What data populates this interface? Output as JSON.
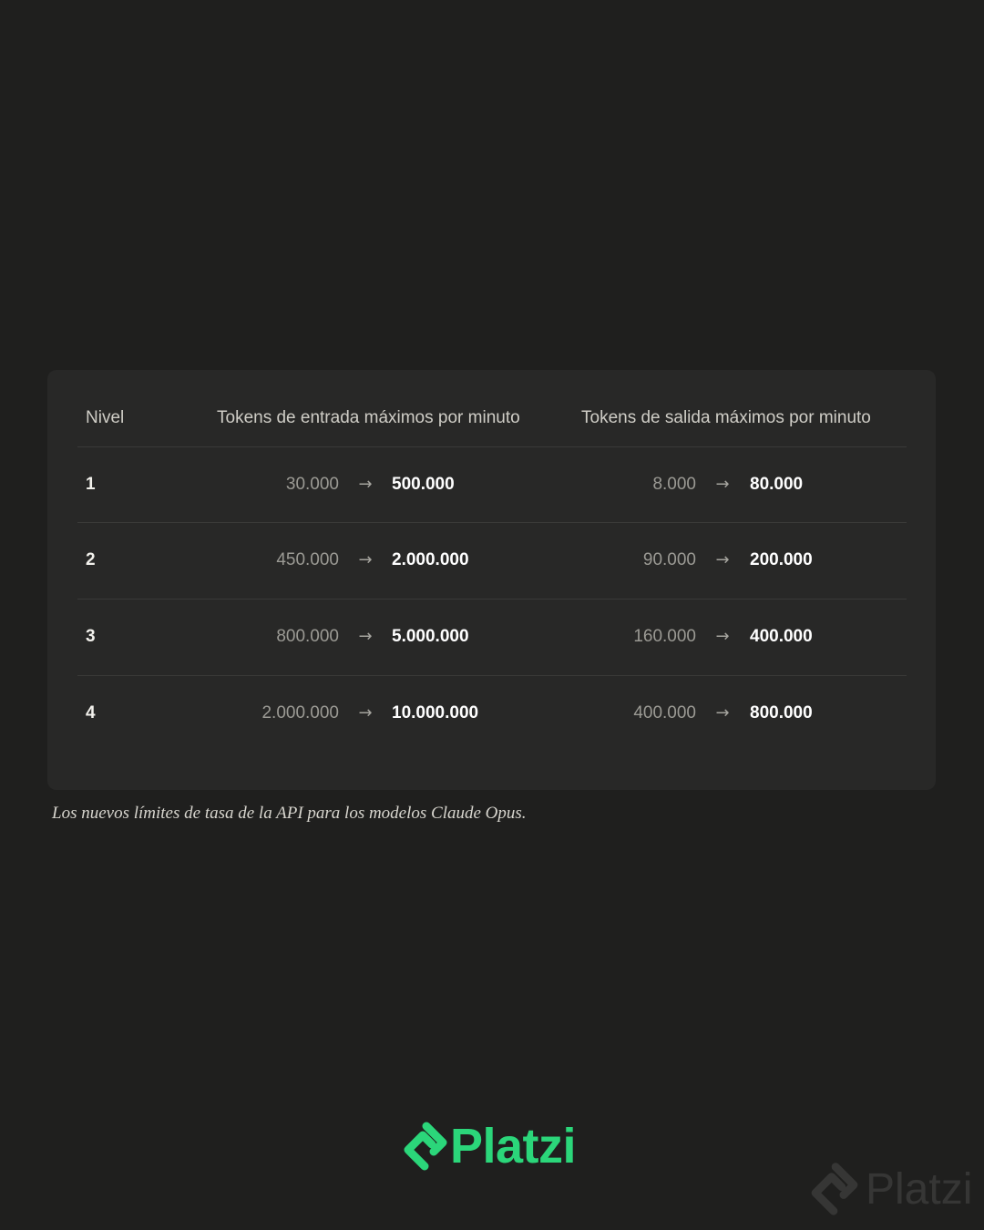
{
  "table": {
    "headers": {
      "level": "Nivel",
      "input": "Tokens de entrada máximos por minuto",
      "output": "Tokens de salida máximos por minuto"
    },
    "arrow": "→",
    "rows": [
      {
        "level": "1",
        "in_old": "30.000",
        "in_new": "500.000",
        "out_old": "8.000",
        "out_new": "80.000"
      },
      {
        "level": "2",
        "in_old": "450.000",
        "in_new": "2.000.000",
        "out_old": "90.000",
        "out_new": "200.000"
      },
      {
        "level": "3",
        "in_old": "800.000",
        "in_new": "5.000.000",
        "out_old": "160.000",
        "out_new": "400.000"
      },
      {
        "level": "4",
        "in_old": "2.000.000",
        "in_new": "10.000.000",
        "out_old": "400.000",
        "out_new": "800.000"
      }
    ]
  },
  "caption": "Los nuevos límites de tasa de la API para los modelos Claude Opus.",
  "brand": {
    "name": "Platzi",
    "watermark": "Platzi",
    "logo_icon": "platzi-logo-icon",
    "accent_color": "#2bd67a",
    "background_color": "#1f1f1e"
  }
}
